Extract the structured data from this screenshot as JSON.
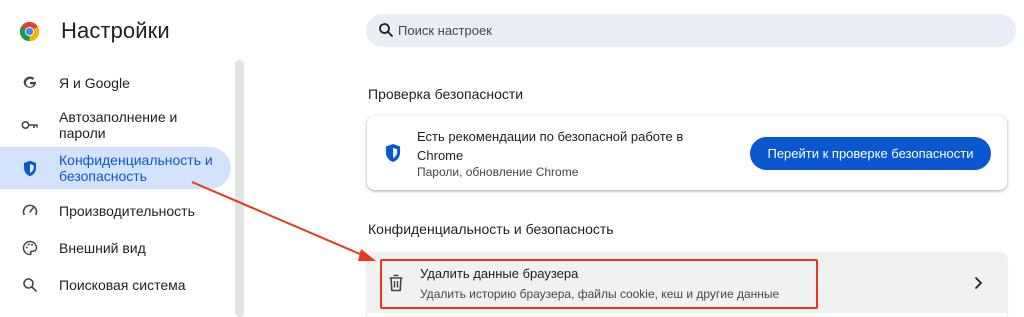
{
  "header": {
    "title": "Настройки",
    "logo_icon": "chrome-logo-icon"
  },
  "search": {
    "placeholder": "Поиск настроек",
    "icon": "search-icon"
  },
  "sidebar": {
    "items": [
      {
        "label": "Я и Google",
        "icon": "google-g-icon",
        "active": false
      },
      {
        "label": "Автозаполнение и\nпароли",
        "icon": "key-icon",
        "active": false
      },
      {
        "label": "Конфиденциальность и\nбезопасность",
        "icon": "shield-icon",
        "active": true
      },
      {
        "label": "Производительность",
        "icon": "speedometer-icon",
        "active": false
      },
      {
        "label": "Внешний вид",
        "icon": "palette-icon",
        "active": false
      },
      {
        "label": "Поисковая система",
        "icon": "search-icon",
        "active": false
      }
    ]
  },
  "safety_check": {
    "section_title": "Проверка безопасности",
    "card_title": "Есть рекомендации по безопасной работе в Chrome",
    "card_subtitle": "Пароли, обновление Chrome",
    "button_label": "Перейти к проверке безопасности"
  },
  "privacy": {
    "section_title": "Конфиденциальность и безопасность",
    "rows": [
      {
        "title": "Удалить данные браузера",
        "subtitle": "Удалить историю браузера, файлы cookie, кеш и другие данные",
        "icon": "trash-icon"
      }
    ]
  },
  "colors": {
    "accent": "#0b57d0",
    "active_bg": "#d3e3fd",
    "annotation": "#e8371e"
  }
}
